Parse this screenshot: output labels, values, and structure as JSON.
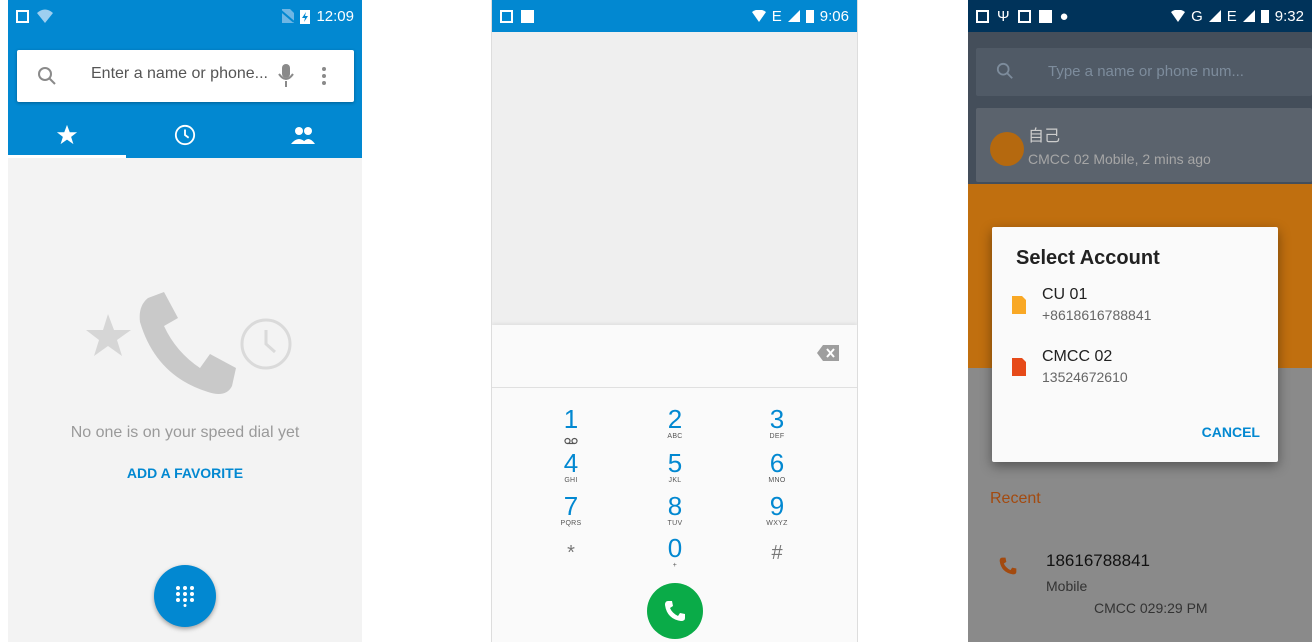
{
  "phone1": {
    "status": {
      "time": "12:09"
    },
    "search": {
      "placeholder": "Enter a name or phone..."
    },
    "tabs": [
      {
        "icon": "star-icon",
        "selected": true
      },
      {
        "icon": "clock-icon",
        "selected": false
      },
      {
        "icon": "people-icon",
        "selected": false
      }
    ],
    "empty_message": "No one is on your speed dial yet",
    "add_favorite": "ADD A FAVORITE",
    "accent": "#0288d1"
  },
  "phone2": {
    "status": {
      "time": "9:06",
      "network": "E"
    },
    "keypad": [
      {
        "num": "1",
        "letters": ""
      },
      {
        "num": "2",
        "letters": "ABC"
      },
      {
        "num": "3",
        "letters": "DEF"
      },
      {
        "num": "4",
        "letters": "GHI"
      },
      {
        "num": "5",
        "letters": "JKL"
      },
      {
        "num": "6",
        "letters": "MNO"
      },
      {
        "num": "7",
        "letters": "PQRS"
      },
      {
        "num": "8",
        "letters": "TUV"
      },
      {
        "num": "9",
        "letters": "WXYZ"
      },
      {
        "num": "*",
        "letters": ""
      },
      {
        "num": "0",
        "letters": "+"
      },
      {
        "num": "#",
        "letters": ""
      }
    ],
    "call_color": "#0aab48"
  },
  "phone3": {
    "status": {
      "time": "9:32",
      "network": "G"
    },
    "bg_search_placeholder": "Type a name or phone num...",
    "bg_contact": {
      "name": "自己",
      "sub": "CMCC 02 Mobile, 2 mins ago"
    },
    "dialog": {
      "title": "Select Account",
      "accounts": [
        {
          "name": "CU 01",
          "number": "+8618616788841",
          "sim_color": "#f9a825"
        },
        {
          "name": "CMCC 02",
          "number": "13524672610",
          "sim_color": "#e64a19"
        }
      ],
      "cancel": "CANCEL"
    },
    "recent": {
      "label": "Recent",
      "number": "18616788841",
      "type": "Mobile",
      "sub": "CMCC 029:29 PM"
    }
  }
}
